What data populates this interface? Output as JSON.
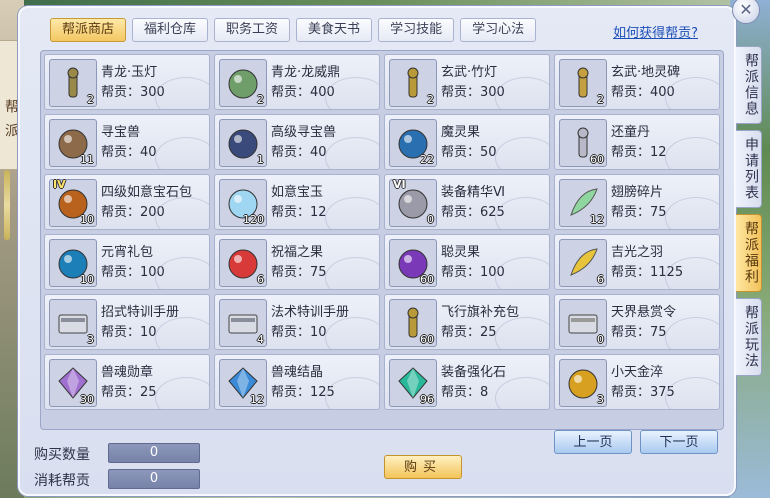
{
  "window": {
    "close_glyph": "✕",
    "left_scroll_label": "帮派"
  },
  "tabs": [
    {
      "label": "帮派商店",
      "active": true
    },
    {
      "label": "福利仓库",
      "active": false
    },
    {
      "label": "职务工资",
      "active": false
    },
    {
      "label": "美食天书",
      "active": false
    },
    {
      "label": "学习技能",
      "active": false
    },
    {
      "label": "学习心法",
      "active": false
    }
  ],
  "help_link": "如何获得帮贡?",
  "items": [
    {
      "name": "青龙·玉灯",
      "price": "帮贡：300",
      "qty": "2",
      "badge": "",
      "icon": "lamp-icon",
      "color": "#9a8a4a"
    },
    {
      "name": "青龙·龙威鼎",
      "price": "帮贡：400",
      "qty": "2",
      "badge": "",
      "icon": "cauldron-icon",
      "color": "#6f9e6a"
    },
    {
      "name": "玄武·竹灯",
      "price": "帮贡：300",
      "qty": "2",
      "badge": "",
      "icon": "bamboo-lamp-icon",
      "color": "#b89a3a"
    },
    {
      "name": "玄武·地灵碑",
      "price": "帮贡：400",
      "qty": "2",
      "badge": "",
      "icon": "stele-icon",
      "color": "#c5a040"
    },
    {
      "name": "寻宝兽",
      "price": "帮贡：40",
      "qty": "11",
      "badge": "",
      "icon": "treasure-beast-icon",
      "color": "#8d6a4a"
    },
    {
      "name": "高级寻宝兽",
      "price": "帮贡：40",
      "qty": "1",
      "badge": "",
      "icon": "advanced-treasure-beast-icon",
      "color": "#3a4a7a"
    },
    {
      "name": "魔灵果",
      "price": "帮贡：50",
      "qty": "22",
      "badge": "",
      "icon": "magic-fruit-icon",
      "color": "#2a6fb0"
    },
    {
      "name": "还童丹",
      "price": "帮贡：12",
      "qty": "60",
      "badge": "",
      "icon": "rejuvenation-pill-icon",
      "color": "#b8b8c8"
    },
    {
      "name": "四级如意宝石包",
      "price": "帮贡：200",
      "qty": "10",
      "badge": "IV",
      "icon": "gem-bag-icon",
      "color": "#b8621e"
    },
    {
      "name": "如意宝玉",
      "price": "帮贡：12",
      "qty": "120",
      "badge": "",
      "icon": "jade-orb-icon",
      "color": "#9fd6f2"
    },
    {
      "name": "装备精华Ⅵ",
      "price": "帮贡：625",
      "qty": "0",
      "badge": "VI",
      "icon": "equipment-essence-icon",
      "color": "#9a9aa8"
    },
    {
      "name": "翅膀碎片",
      "price": "帮贡：75",
      "qty": "12",
      "badge": "",
      "icon": "wing-fragment-icon",
      "color": "#8fd6a0"
    },
    {
      "name": "元宵礼包",
      "price": "帮贡：100",
      "qty": "10",
      "badge": "",
      "icon": "lantern-gift-bag-icon",
      "color": "#1d7fb8"
    },
    {
      "name": "祝福之果",
      "price": "帮贡：75",
      "qty": "6",
      "badge": "",
      "icon": "blessing-fruit-icon",
      "color": "#d83a3a"
    },
    {
      "name": "聪灵果",
      "price": "帮贡：100",
      "qty": "60",
      "badge": "",
      "icon": "wisdom-fruit-icon",
      "color": "#7a3ab8"
    },
    {
      "name": "吉光之羽",
      "price": "帮贡：1125",
      "qty": "6",
      "badge": "",
      "icon": "golden-feather-icon",
      "color": "#e8c43a"
    },
    {
      "name": "招式特训手册",
      "price": "帮贡：10",
      "qty": "3",
      "badge": "",
      "icon": "skill-manual-icon",
      "color": "#8a8e9a"
    },
    {
      "name": "法术特训手册",
      "price": "帮贡：10",
      "qty": "4",
      "badge": "",
      "icon": "spell-manual-icon",
      "color": "#8a8e9a"
    },
    {
      "name": "飞行旗补充包",
      "price": "帮贡：25",
      "qty": "60",
      "badge": "",
      "icon": "flight-flag-pack-icon",
      "color": "#b89a3a"
    },
    {
      "name": "天界悬赏令",
      "price": "帮贡：75",
      "qty": "0",
      "badge": "",
      "icon": "bounty-scroll-icon",
      "color": "#9a9a9a"
    },
    {
      "name": "兽魂勋章",
      "price": "帮贡：25",
      "qty": "30",
      "badge": "",
      "icon": "beast-soul-medal-icon",
      "color": "#a070d0"
    },
    {
      "name": "兽魂结晶",
      "price": "帮贡：125",
      "qty": "12",
      "badge": "",
      "icon": "beast-soul-crystal-icon",
      "color": "#3a8ad8"
    },
    {
      "name": "装备强化石",
      "price": "帮贡：8",
      "qty": "96",
      "badge": "",
      "icon": "enhancement-stone-icon",
      "color": "#2ab89a"
    },
    {
      "name": "小天金淬",
      "price": "帮贡：375",
      "qty": "3",
      "badge": "",
      "icon": "gold-temper-icon",
      "color": "#d8a020"
    }
  ],
  "purchase": {
    "quantity_label": "购买数量",
    "quantity_value": "0",
    "cost_label": "消耗帮贡",
    "cost_value": "0",
    "buy_label": "购买"
  },
  "pagination": {
    "prev_label": "上一页",
    "next_label": "下一页"
  },
  "side_tabs": [
    {
      "label": "帮派信息",
      "active": false
    },
    {
      "label": "申请列表",
      "active": false
    },
    {
      "label": "帮派福利",
      "active": true
    },
    {
      "label": "帮派玩法",
      "active": false
    }
  ]
}
